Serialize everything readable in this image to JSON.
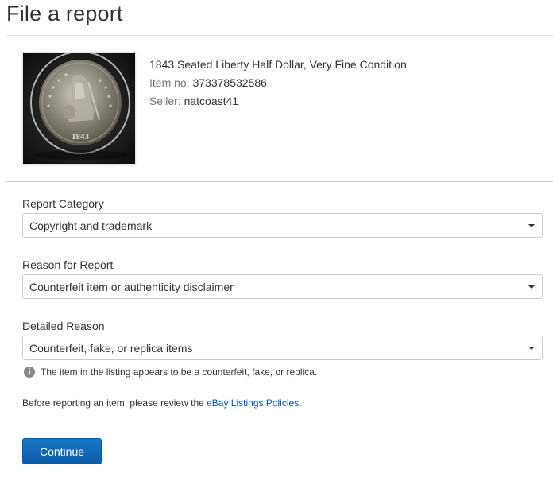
{
  "page": {
    "title": "File a report"
  },
  "item": {
    "image_alt": "1843 Seated Liberty Half Dollar coin photo",
    "coin_year": "1843",
    "title": "1843 Seated Liberty Half Dollar, Very Fine Condition",
    "item_no_label": "Item no:",
    "item_no": "373378532586",
    "seller_label": "Seller:",
    "seller": "natcoast41"
  },
  "form": {
    "category": {
      "label": "Report Category",
      "selected": "Copyright and trademark"
    },
    "reason": {
      "label": "Reason for Report",
      "selected": "Counterfeit item or authenticity disclaimer"
    },
    "detailed": {
      "label": "Detailed Reason",
      "selected": "Counterfeit, fake, or replica items"
    },
    "info_icon": "info-icon",
    "info_text": "The item in the listing appears to be a counterfeit, fake, or replica.",
    "policy_prefix": "Before reporting an item, please review the ",
    "policy_link": "eBay Listings Policies",
    "policy_suffix": ".",
    "continue_label": "Continue"
  },
  "colors": {
    "link": "#0654ba",
    "button": "#0a5ca8",
    "text": "#333333",
    "muted": "#767676"
  }
}
